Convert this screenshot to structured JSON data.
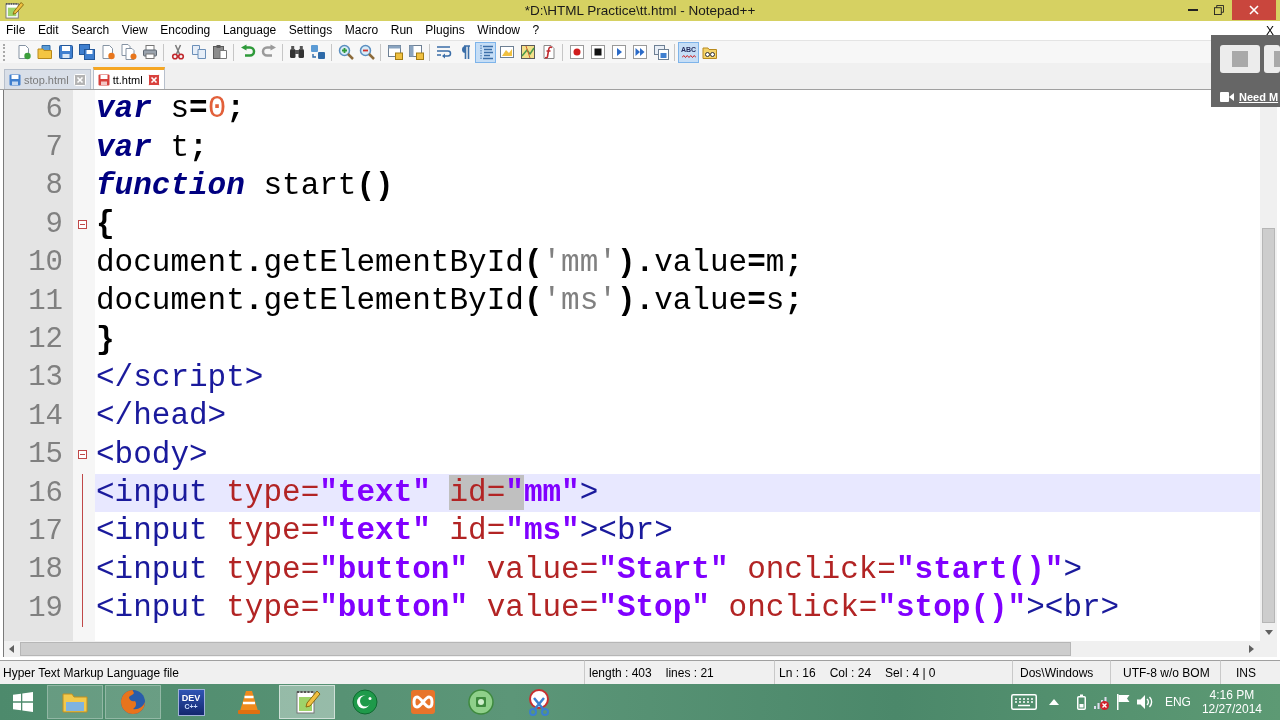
{
  "window": {
    "title": "*D:\\HTML Practice\\tt.html - Notepad++"
  },
  "menu": {
    "items": [
      "File",
      "Edit",
      "Search",
      "View",
      "Encoding",
      "Language",
      "Settings",
      "Macro",
      "Run",
      "Plugins",
      "Window",
      "?"
    ],
    "close_document": "X"
  },
  "toolbar": [
    {
      "buttons": [
        {
          "kind": "new",
          "on": false
        },
        {
          "kind": "open",
          "on": false
        },
        {
          "kind": "save",
          "on": false
        },
        {
          "kind": "save_all",
          "on": false
        },
        {
          "kind": "close",
          "on": false
        },
        {
          "kind": "close_all",
          "on": false
        },
        {
          "kind": "print",
          "on": false
        }
      ]
    },
    {
      "buttons": [
        {
          "kind": "cut",
          "on": false
        },
        {
          "kind": "copy",
          "on": false
        },
        {
          "kind": "paste",
          "on": false
        }
      ]
    },
    {
      "buttons": [
        {
          "kind": "undo",
          "on": false
        },
        {
          "kind": "redo",
          "on": false
        }
      ]
    },
    {
      "buttons": [
        {
          "kind": "find",
          "on": false
        },
        {
          "kind": "replace",
          "on": false
        }
      ]
    },
    {
      "buttons": [
        {
          "kind": "zoom_in",
          "on": false
        },
        {
          "kind": "zoom_out",
          "on": false
        }
      ]
    },
    {
      "buttons": [
        {
          "kind": "sync_vertical",
          "on": false
        },
        {
          "kind": "sync_horizontal",
          "on": false
        }
      ]
    },
    {
      "buttons": [
        {
          "kind": "word_wrap",
          "on": false
        },
        {
          "kind": "show_all",
          "on": false
        },
        {
          "kind": "indent_guide",
          "on": true
        },
        {
          "kind": "user_language",
          "on": false
        },
        {
          "kind": "document_map",
          "on": false
        },
        {
          "kind": "function_list",
          "on": false
        }
      ]
    },
    {
      "buttons": [
        {
          "kind": "record",
          "on": false
        },
        {
          "kind": "stop",
          "on": false
        },
        {
          "kind": "play",
          "on": false
        },
        {
          "kind": "play_multiple",
          "on": false
        },
        {
          "kind": "save_macro",
          "on": false
        }
      ]
    },
    {
      "buttons": [
        {
          "kind": "spell_check",
          "on": true,
          "text": "ABC"
        },
        {
          "kind": "folder",
          "on": false
        }
      ]
    }
  ],
  "tabs": [
    {
      "label": "stop.html",
      "selected": false,
      "modified": false
    },
    {
      "label": "tt.html",
      "selected": true,
      "modified": true
    }
  ],
  "editor": {
    "lines": [
      {
        "number": "6",
        "current": false,
        "fold_marker": false,
        "fold_line": false,
        "tokens": [
          {
            "kind": "keyword",
            "text": "var"
          },
          {
            "kind": "plain",
            "text": " s"
          },
          {
            "kind": "operator",
            "text": "="
          },
          {
            "kind": "number",
            "text": "0"
          },
          {
            "kind": "operator",
            "text": ";"
          }
        ]
      },
      {
        "number": "7",
        "current": false,
        "fold_marker": false,
        "fold_line": false,
        "tokens": [
          {
            "kind": "keyword",
            "text": "var"
          },
          {
            "kind": "plain",
            "text": " t"
          },
          {
            "kind": "operator",
            "text": ";"
          }
        ]
      },
      {
        "number": "8",
        "current": false,
        "fold_marker": false,
        "fold_line": false,
        "tokens": [
          {
            "kind": "keyword",
            "text": "function"
          },
          {
            "kind": "plain",
            "text": " start"
          },
          {
            "kind": "operator",
            "text": "()"
          }
        ]
      },
      {
        "number": "9",
        "current": false,
        "fold_marker": true,
        "fold_line": false,
        "tokens": [
          {
            "kind": "operator",
            "text": "{"
          }
        ]
      },
      {
        "number": "10",
        "current": false,
        "fold_marker": false,
        "fold_line": false,
        "tokens": [
          {
            "kind": "plain",
            "text": "document"
          },
          {
            "kind": "operator",
            "text": "."
          },
          {
            "kind": "plain",
            "text": "getElementById"
          },
          {
            "kind": "operator",
            "text": "("
          },
          {
            "kind": "string_single",
            "text": "'mm'"
          },
          {
            "kind": "operator",
            "text": ")."
          },
          {
            "kind": "plain",
            "text": "value"
          },
          {
            "kind": "operator",
            "text": "="
          },
          {
            "kind": "plain",
            "text": "m"
          },
          {
            "kind": "operator",
            "text": ";"
          }
        ]
      },
      {
        "number": "11",
        "current": false,
        "fold_marker": false,
        "fold_line": false,
        "tokens": [
          {
            "kind": "plain",
            "text": "document"
          },
          {
            "kind": "operator",
            "text": "."
          },
          {
            "kind": "plain",
            "text": "getElementById"
          },
          {
            "kind": "operator",
            "text": "("
          },
          {
            "kind": "string_single",
            "text": "'ms'"
          },
          {
            "kind": "operator",
            "text": ")."
          },
          {
            "kind": "plain",
            "text": "value"
          },
          {
            "kind": "operator",
            "text": "="
          },
          {
            "kind": "plain",
            "text": "s"
          },
          {
            "kind": "operator",
            "text": ";"
          }
        ]
      },
      {
        "number": "12",
        "current": false,
        "fold_marker": false,
        "fold_line": false,
        "tokens": [
          {
            "kind": "operator",
            "text": "}"
          }
        ]
      },
      {
        "number": "13",
        "current": false,
        "fold_marker": false,
        "fold_line": false,
        "tokens": [
          {
            "kind": "tag",
            "text": "</script>"
          }
        ]
      },
      {
        "number": "14",
        "current": false,
        "fold_marker": false,
        "fold_line": false,
        "tokens": [
          {
            "kind": "tag",
            "text": "</head>"
          }
        ]
      },
      {
        "number": "15",
        "current": false,
        "fold_marker": true,
        "fold_line": false,
        "tokens": [
          {
            "kind": "tag",
            "text": "<body>"
          }
        ]
      },
      {
        "number": "16",
        "current": true,
        "fold_marker": false,
        "fold_line": true,
        "tokens": [
          {
            "kind": "tag",
            "text": "<input",
            "selected": false
          },
          {
            "kind": "attribute",
            "text": " type=",
            "selected": false
          },
          {
            "kind": "string",
            "text": "\"text\" ",
            "selected": false
          },
          {
            "kind": "attribute",
            "text": "id=",
            "selected": true
          },
          {
            "kind": "string",
            "text": "\"",
            "selected": true
          },
          {
            "kind": "string",
            "text": "mm\"",
            "selected": false
          },
          {
            "kind": "tag",
            "text": ">",
            "selected": false
          }
        ]
      },
      {
        "number": "17",
        "current": false,
        "fold_marker": false,
        "fold_line": true,
        "tokens": [
          {
            "kind": "tag",
            "text": "<input"
          },
          {
            "kind": "attribute",
            "text": " type="
          },
          {
            "kind": "string",
            "text": "\"text\""
          },
          {
            "kind": "attribute",
            "text": " id="
          },
          {
            "kind": "string",
            "text": "\"ms\""
          },
          {
            "kind": "tag",
            "text": "><br>"
          }
        ]
      },
      {
        "number": "18",
        "current": false,
        "fold_marker": false,
        "fold_line": true,
        "tokens": [
          {
            "kind": "tag",
            "text": "<input"
          },
          {
            "kind": "attribute",
            "text": " type="
          },
          {
            "kind": "string",
            "text": "\"button\""
          },
          {
            "kind": "attribute",
            "text": " value="
          },
          {
            "kind": "string",
            "text": "\"Start\""
          },
          {
            "kind": "attribute",
            "text": " onclick="
          },
          {
            "kind": "string",
            "text": "\"start()\""
          },
          {
            "kind": "tag",
            "text": ">"
          }
        ]
      },
      {
        "number": "19",
        "current": false,
        "fold_marker": false,
        "fold_line": true,
        "tokens": [
          {
            "kind": "tag",
            "text": "<input"
          },
          {
            "kind": "attribute",
            "text": " type="
          },
          {
            "kind": "string",
            "text": "\"button\""
          },
          {
            "kind": "attribute",
            "text": " value="
          },
          {
            "kind": "string",
            "text": "\"Stop\""
          },
          {
            "kind": "attribute",
            "text": " onclick="
          },
          {
            "kind": "string",
            "text": "\"stop()\""
          },
          {
            "kind": "tag",
            "text": "><br>"
          }
        ]
      }
    ]
  },
  "status_bar": [
    {
      "texts": [
        "Hyper Text Markup Language file"
      ]
    },
    {
      "texts": [
        "length : 403",
        "lines : 21"
      ]
    },
    {
      "texts": [
        "Ln : 16",
        "Col : 24",
        "Sel : 4 | 0"
      ]
    },
    {
      "texts": [
        "Dos\\Windows"
      ]
    },
    {
      "texts": [
        "UTF-8 w/o BOM"
      ]
    },
    {
      "texts": [
        "INS"
      ]
    }
  ],
  "taskbar": {
    "items": [
      {
        "kind": "folder",
        "open": true,
        "selected": false
      },
      {
        "kind": "globe",
        "open": true,
        "selected": false
      },
      {
        "kind": "ide",
        "open": false,
        "selected": false,
        "text": [
          "DEV",
          "C++"
        ]
      },
      {
        "kind": "cone",
        "open": false,
        "selected": false
      },
      {
        "kind": "notepad",
        "open": true,
        "selected": true
      },
      {
        "kind": "crescent",
        "open": false,
        "selected": false
      },
      {
        "kind": "knot",
        "open": false,
        "selected": false
      },
      {
        "kind": "disc",
        "open": false,
        "selected": false
      },
      {
        "kind": "scissors",
        "open": false,
        "selected": false
      }
    ],
    "tray": {
      "icons": [
        {
          "kind": "keyboard"
        },
        {
          "kind": "chevron"
        },
        {
          "kind": "battery"
        },
        {
          "kind": "network_error"
        },
        {
          "kind": "flag"
        },
        {
          "kind": "speaker"
        }
      ],
      "language": "ENG",
      "time": "4:16 PM",
      "date": "12/27/2014"
    }
  },
  "overlay": {
    "link": "Need M"
  }
}
